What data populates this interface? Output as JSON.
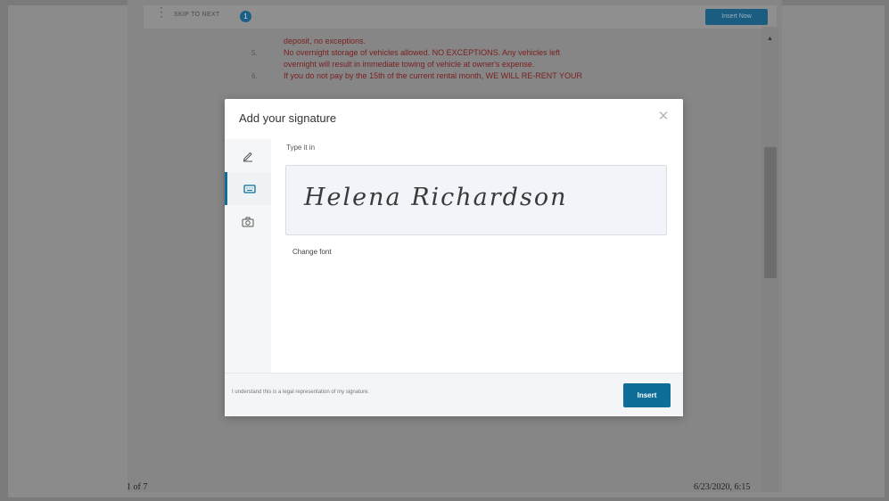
{
  "document": {
    "toolbar": {
      "step_label": "SKIP TO NEXT",
      "step_count": "1",
      "finish_button": "Insert Now"
    },
    "lines": [
      {
        "num": "",
        "text": "deposit, no exceptions."
      },
      {
        "num": "5.",
        "text": "No overnight storage of vehicles allowed. NO EXCEPTIONS.  Any vehicles left"
      },
      {
        "num": "",
        "text": "overnight will result in immediate towing of vehicle at owner's expense."
      },
      {
        "num": "6.",
        "text": "If you do not pay by the 15th of the current rental month, WE WILL RE-RENT YOUR"
      }
    ],
    "page_indicator": "1 of 7",
    "timestamp": "6/23/2020, 6:15"
  },
  "modal": {
    "title": "Add your signature",
    "tabs": [
      {
        "name": "draw",
        "icon": "pen-icon"
      },
      {
        "name": "type",
        "icon": "keyboard-icon"
      },
      {
        "name": "upload",
        "icon": "camera-icon"
      }
    ],
    "type_label": "Type it in",
    "signature_text": "Helena Richardson",
    "change_font_label": "Change font",
    "legal_text": "I understand this is a legal representation of my signature.",
    "insert_button": "Insert"
  },
  "colors": {
    "accent": "#0f6e97",
    "overlay": "#7a7a7a",
    "doc_text": "#7a2020"
  }
}
